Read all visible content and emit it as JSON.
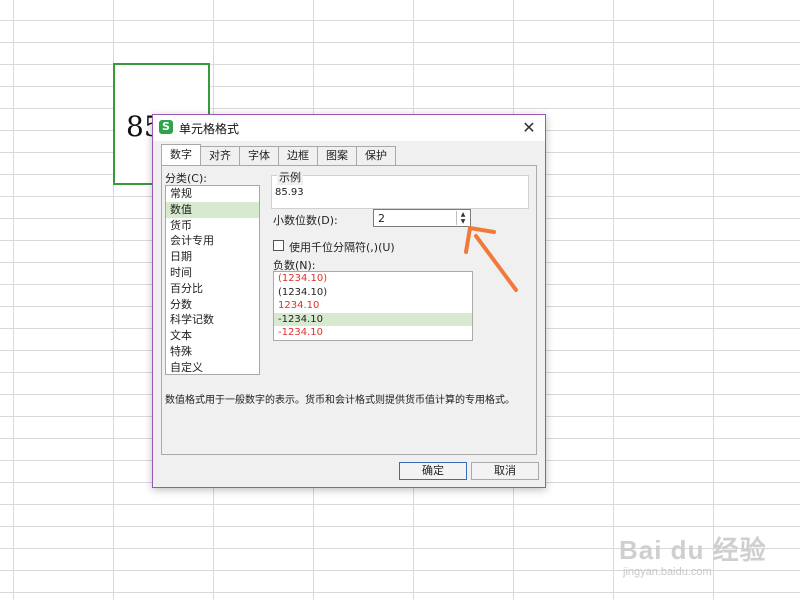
{
  "sheet": {
    "cell_value": "85"
  },
  "dialog": {
    "title": "单元格格式",
    "tabs": [
      {
        "label": "数字",
        "active": true
      },
      {
        "label": "对齐",
        "active": false
      },
      {
        "label": "字体",
        "active": false
      },
      {
        "label": "边框",
        "active": false
      },
      {
        "label": "图案",
        "active": false
      },
      {
        "label": "保护",
        "active": false
      }
    ],
    "category_label": "分类(C):",
    "categories": [
      "常规",
      "数值",
      "货币",
      "会计专用",
      "日期",
      "时间",
      "百分比",
      "分数",
      "科学记数",
      "文本",
      "特殊",
      "自定义"
    ],
    "selected_category": "数值",
    "sample_label": "示例",
    "sample_value": "85.93",
    "decimal_label": "小数位数(D):",
    "decimal_value": "2",
    "thousands_label": "使用千位分隔符(,)(U)",
    "thousands_checked": false,
    "negative_label": "负数(N):",
    "negative_options": [
      {
        "text": "(1234.10)",
        "color": "#e0302a"
      },
      {
        "text": "(1234.10)",
        "color": "#222222"
      },
      {
        "text": "1234.10",
        "color": "#e0302a"
      },
      {
        "text": "-1234.10",
        "color": "#222222",
        "selected": true
      },
      {
        "text": "-1234.10",
        "color": "#e0302a"
      }
    ],
    "description": "数值格式用于一般数字的表示。货币和会计格式则提供货币值计算的专用格式。",
    "ok_label": "确定",
    "cancel_label": "取消"
  },
  "colors": {
    "selection": "#d7e9cf",
    "dialog_border": "#9b59b6",
    "cell_border": "#3a9a3a",
    "arrow": "#f07a3a",
    "negative_red": "#e0302a"
  },
  "watermark": {
    "brand": "Bai du 经验",
    "url": "jingyan.baidu.com"
  }
}
